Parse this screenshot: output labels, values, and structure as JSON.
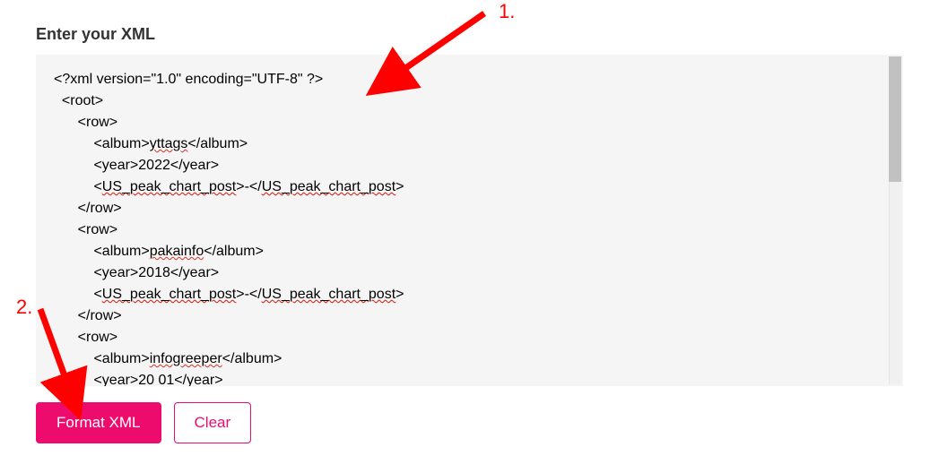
{
  "heading": "Enter your XML",
  "xml_lines": [
    {
      "text": "<?xml version=\"1.0\" encoding=\"UTF-8\" ?>",
      "indent": 0,
      "wavy": []
    },
    {
      "text": "<root>",
      "indent": 1,
      "wavy": []
    },
    {
      "text": "<row>",
      "indent": 3,
      "wavy": []
    },
    {
      "text": "<album>yttags</album>",
      "indent": 5,
      "wavy": [
        "yttags"
      ]
    },
    {
      "text": "<year>2022</year>",
      "indent": 5,
      "wavy": []
    },
    {
      "text": "<US_peak_chart_post>-</US_peak_chart_post>",
      "indent": 5,
      "wavy": [
        "US_peak_chart_post",
        "US_peak_chart_post"
      ]
    },
    {
      "text": "</row>",
      "indent": 3,
      "wavy": []
    },
    {
      "text": "<row>",
      "indent": 3,
      "wavy": []
    },
    {
      "text": "<album>pakainfo</album>",
      "indent": 5,
      "wavy": [
        "pakainfo"
      ]
    },
    {
      "text": "<year>2018</year>",
      "indent": 5,
      "wavy": []
    },
    {
      "text": "<US_peak_chart_post>-</US_peak_chart_post>",
      "indent": 5,
      "wavy": [
        "US_peak_chart_post",
        "US_peak_chart_post"
      ]
    },
    {
      "text": "</row>",
      "indent": 3,
      "wavy": []
    },
    {
      "text": "<row>",
      "indent": 3,
      "wavy": []
    },
    {
      "text": "<album>infogreeper</album>",
      "indent": 5,
      "wavy": [
        "infogreeper"
      ]
    },
    {
      "text": "<year>20 01</year>",
      "indent": 5,
      "wavy": []
    }
  ],
  "buttons": {
    "format": "Format XML",
    "clear": "Clear"
  },
  "annotations": {
    "num1": "1.",
    "num2": "2."
  },
  "colors": {
    "accent": "#ed0c6e",
    "annotation": "#ff0000"
  }
}
